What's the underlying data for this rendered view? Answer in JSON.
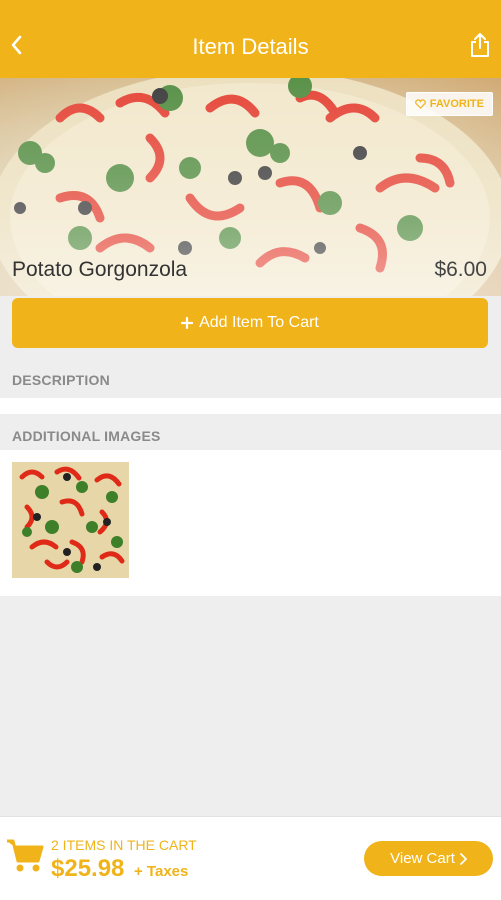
{
  "header": {
    "title": "Item Details",
    "back_icon": "chevron-left-icon",
    "share_icon": "share-icon"
  },
  "item": {
    "name": "Potato Gorgonzola",
    "price": "$6.00",
    "favorite_label": "FAVORITE"
  },
  "actions": {
    "add_to_cart_label": "Add Item To Cart"
  },
  "sections": {
    "description_title": "DESCRIPTION",
    "additional_images_title": "ADDITIONAL IMAGES"
  },
  "cart": {
    "items_count_text": "2 ITEMS IN THE CART",
    "total": "$25.98",
    "taxes_text": "+ Taxes",
    "view_cart_label": "View Cart"
  },
  "colors": {
    "accent": "#f0b41a",
    "background": "#eeeeee"
  }
}
